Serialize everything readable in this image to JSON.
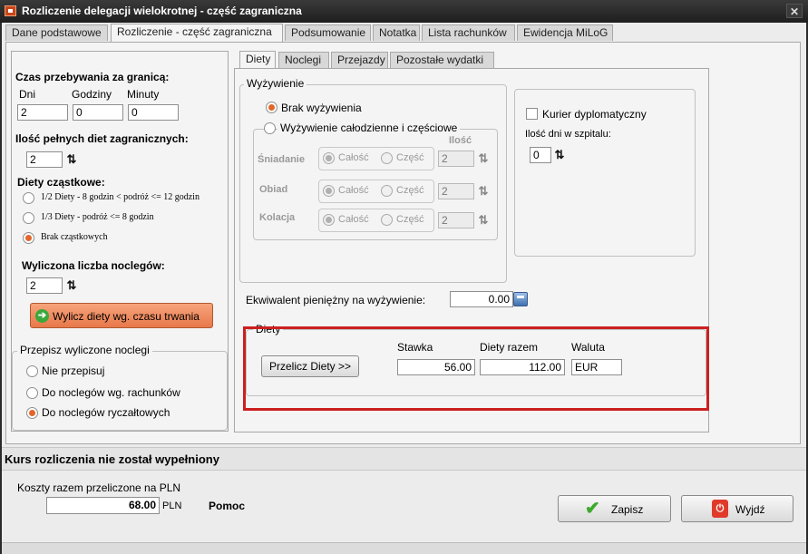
{
  "window": {
    "title": "Rozliczenie delegacji wielokrotnej - część zagraniczna",
    "close": "✕"
  },
  "main_tabs": [
    "Dane podstawowe",
    "Rozliczenie - część zagraniczna",
    "Podsumowanie",
    "Notatka",
    "Lista rachunków",
    "Ewidencja MiLoG"
  ],
  "left": {
    "czas_title": "Czas przebywania za granicą:",
    "dni_label": "Dni",
    "godziny_label": "Godziny",
    "minuty_label": "Minuty",
    "dni_value": "2",
    "godziny_value": "0",
    "minuty_value": "0",
    "pelne_title": "Ilość pełnych diet zagranicznych:",
    "pelne_value": "2",
    "czastkowe_title": "Diety cząstkowe:",
    "czastkowe_options": [
      "1/2 Diety - 8 godzin < podróż <= 12 godzin",
      "1/3 Diety - podróż <= 8 godzin",
      "Brak cząstkowych"
    ],
    "noclegi_title": "Wyliczona liczba noclegów:",
    "noclegi_value": "2",
    "wylicz_button": "Wylicz diety wg. czasu trwania",
    "przepisz_title": "Przepisz wyliczone noclegi",
    "przepisz_options": [
      "Nie przepisuj",
      "Do noclegów wg. rachunków",
      "Do noclegów ryczałtowych"
    ]
  },
  "sub_tabs": [
    "Diety",
    "Noclegi",
    "Przejazdy",
    "Pozostałe wydatki"
  ],
  "wyzywienie": {
    "title": "Wyżywienie",
    "brak": "Brak wyżywienia",
    "calodzienne": "Wyżywienie całodzienne i częściowe",
    "ilosc_header": "Ilość",
    "rows": [
      {
        "label": "Śniadanie",
        "calosc": "Całość",
        "czesc": "Część",
        "value": "2"
      },
      {
        "label": "Obiad",
        "calosc": "Całość",
        "czesc": "Część",
        "value": "2"
      },
      {
        "label": "Kolacja",
        "calosc": "Całość",
        "czesc": "Część",
        "value": "2"
      }
    ]
  },
  "kurier": {
    "label": "Kurier dyplomatyczny",
    "szpital_label": "Ilość dni w szpitalu:",
    "szpital_value": "0"
  },
  "ekwiwalent": {
    "label": "Ekwiwalent pieniężny na wyżywienie:",
    "value": "0.00"
  },
  "diety": {
    "title": "Diety",
    "przelicz_button": "Przelicz Diety >>",
    "stawka_label": "Stawka",
    "razem_label": "Diety razem",
    "waluta_label": "Waluta",
    "stawka_value": "56.00",
    "razem_value": "112.00",
    "waluta_value": "EUR"
  },
  "bottom": {
    "kurs_text": "Kurs  rozliczenia nie został wypełniony",
    "koszty_label": "Koszty razem przeliczone na PLN",
    "koszty_value": "68.00",
    "koszty_currency": "PLN",
    "pomoc": "Pomoc",
    "zapisz": "Zapisz",
    "wyjdz": "Wyjdź"
  },
  "colors": {
    "accent": "#e2662a",
    "highlight_border": "#cc1f1f",
    "wylicz_button": "#f08a60"
  }
}
